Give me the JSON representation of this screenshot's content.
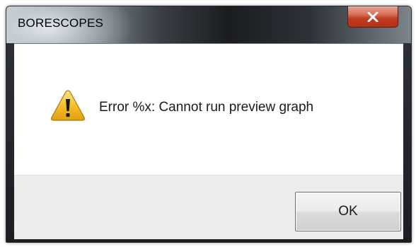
{
  "dialog": {
    "title": "BORESCOPES",
    "message": "Error %x: Cannot run preview graph",
    "icon": "warning-icon",
    "close_icon": "close-icon",
    "ok_label": "OK"
  },
  "colors": {
    "close_button": "#c7442a",
    "warning_fill": "#f5c02a",
    "content_bg": "#ffffff",
    "button_area_bg": "#ececec"
  }
}
